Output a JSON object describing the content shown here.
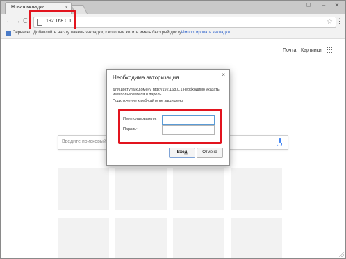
{
  "tab": {
    "title": "Новая вкладка",
    "close_glyph": "×"
  },
  "window_controls": {
    "minimize": "–",
    "close": "✕",
    "restore": "▢"
  },
  "nav": {
    "back": "←",
    "forward": "→",
    "reload": "C"
  },
  "omnibox": {
    "url": "192.168.0.1",
    "star_glyph": "☆"
  },
  "menu_glyph": "⋮",
  "bookmarks": {
    "apps_label": "Сервисы",
    "hint": "Добавляйте на эту панель закладки, к которым хотите иметь быстрый доступ.",
    "import_link": "Импортировать закладки..."
  },
  "ntp": {
    "links": [
      "Почта",
      "Картинки"
    ],
    "search_placeholder": "Введите поисковый",
    "tile_count": 8
  },
  "dialog": {
    "title": "Необходима авторизация",
    "message": "Для доступа к домену http://192.168.0.1 необходимо указать имя пользователя и пароль.",
    "warning": "Подключение к веб-сайту не защищено",
    "username_label": "Имя пользователя:",
    "password_label": "Пароль:",
    "username_value": "",
    "password_value": "",
    "login_button": "Вход",
    "cancel_button": "Отмена",
    "close_glyph": "×"
  },
  "colors": {
    "highlight": "#e2141e",
    "link": "#3366cc",
    "mic": "#4285f4",
    "focus": "#5b9bd5"
  }
}
